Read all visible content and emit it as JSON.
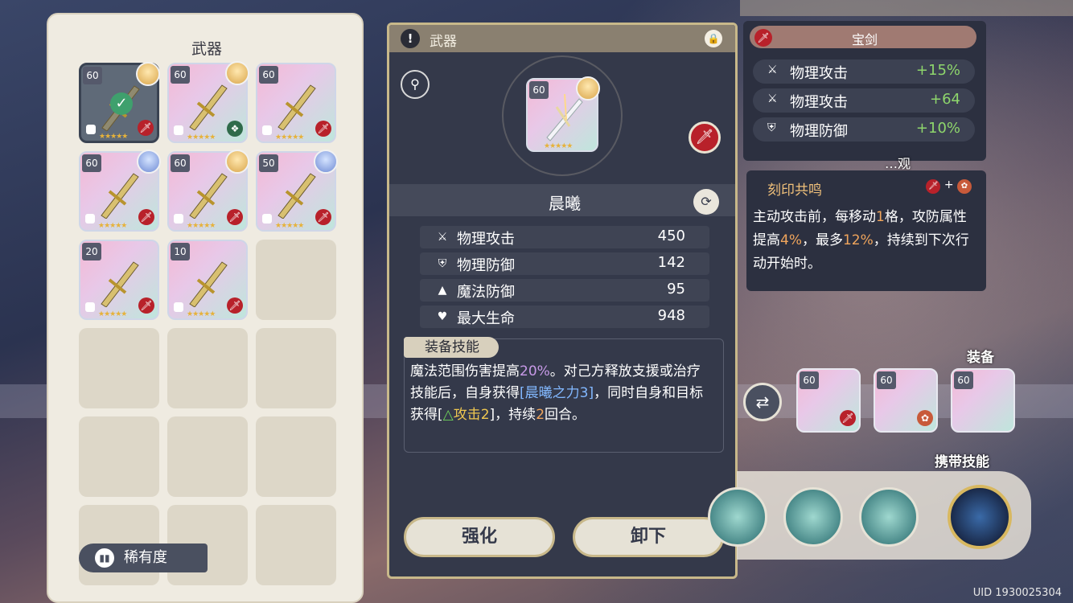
{
  "inventory": {
    "title": "武器",
    "rarity_label": "稀有度",
    "items": [
      {
        "level": "60",
        "avatar": "gold",
        "element": "red",
        "selected": true,
        "check": "✓",
        "weapon": "sword-dark"
      },
      {
        "level": "60",
        "avatar": "gold",
        "element": "green",
        "selected": false,
        "weapon": "dagger"
      },
      {
        "level": "60",
        "avatar": "",
        "element": "red",
        "selected": false,
        "weapon": "greatsword"
      },
      {
        "level": "60",
        "avatar": "blue",
        "element": "red",
        "selected": false,
        "weapon": "golden-blade"
      },
      {
        "level": "60",
        "avatar": "gold",
        "element": "red",
        "selected": false,
        "weapon": "red-sword"
      },
      {
        "level": "50",
        "avatar": "blue",
        "element": "red",
        "selected": false,
        "weapon": "blue-sword"
      },
      {
        "level": "20",
        "avatar": "",
        "element": "red",
        "selected": false,
        "weapon": "golden-blade"
      },
      {
        "level": "10",
        "avatar": "",
        "element": "red",
        "selected": false,
        "weapon": "white-sword"
      }
    ]
  },
  "detail": {
    "header_title": "武器",
    "header_warn": "!",
    "level": "60",
    "name": "晨曦",
    "stats": [
      {
        "icon": "sword-icon",
        "glyph": "⚔",
        "label": "物理攻击",
        "value": "450"
      },
      {
        "icon": "shield-icon",
        "glyph": "⛨",
        "label": "物理防御",
        "value": "142"
      },
      {
        "icon": "hat-icon",
        "glyph": "▲",
        "label": "魔法防御",
        "value": "95"
      },
      {
        "icon": "heart-icon",
        "glyph": "♥",
        "label": "最大生命",
        "value": "948"
      }
    ],
    "skill_tag": "装备技能",
    "skill_text": {
      "p1": "魔法范围伤害提高",
      "p2": "20%",
      "p3": "。对己方释放支援或治疗技能后，自身获得",
      "p4": "[晨曦之力3]",
      "p5": "，同时自身和目标获得[",
      "p6": "△",
      "p7": "攻击2",
      "p8": "]，持续",
      "p9": "2",
      "p10": "回合。"
    },
    "btn_enhance": "强化",
    "btn_unequip": "卸下"
  },
  "attributes": {
    "header": "宝剑",
    "rows": [
      {
        "icon": "sword-icon",
        "glyph": "⚔",
        "label": "物理攻击",
        "value": "+15%"
      },
      {
        "icon": "sword-icon",
        "glyph": "⚔",
        "label": "物理攻击",
        "value": "+64"
      },
      {
        "icon": "shield-icon",
        "glyph": "⛨",
        "label": "物理防御",
        "value": "+10%"
      }
    ]
  },
  "resonance": {
    "title": "刻印共鸣",
    "plus": "+",
    "t1": "主动攻击前，每移动",
    "t2": "1",
    "t3": "格，攻防属性提高",
    "t4": "4%",
    "t5": "，最多",
    "t6": "12%",
    "t7": "，持续到下次行动开始时。"
  },
  "side": {
    "appearance_label": "…观",
    "equip_label": "装备",
    "equip_levels": [
      "60",
      "60",
      "60"
    ],
    "skills_label": "携带技能"
  },
  "uid": "UID 1930025304",
  "colors": {
    "accent_gold": "#c8b88a",
    "element_red": "#b8212a",
    "bonus_green": "#8ed66c",
    "highlight_purple": "#c89ae8"
  }
}
